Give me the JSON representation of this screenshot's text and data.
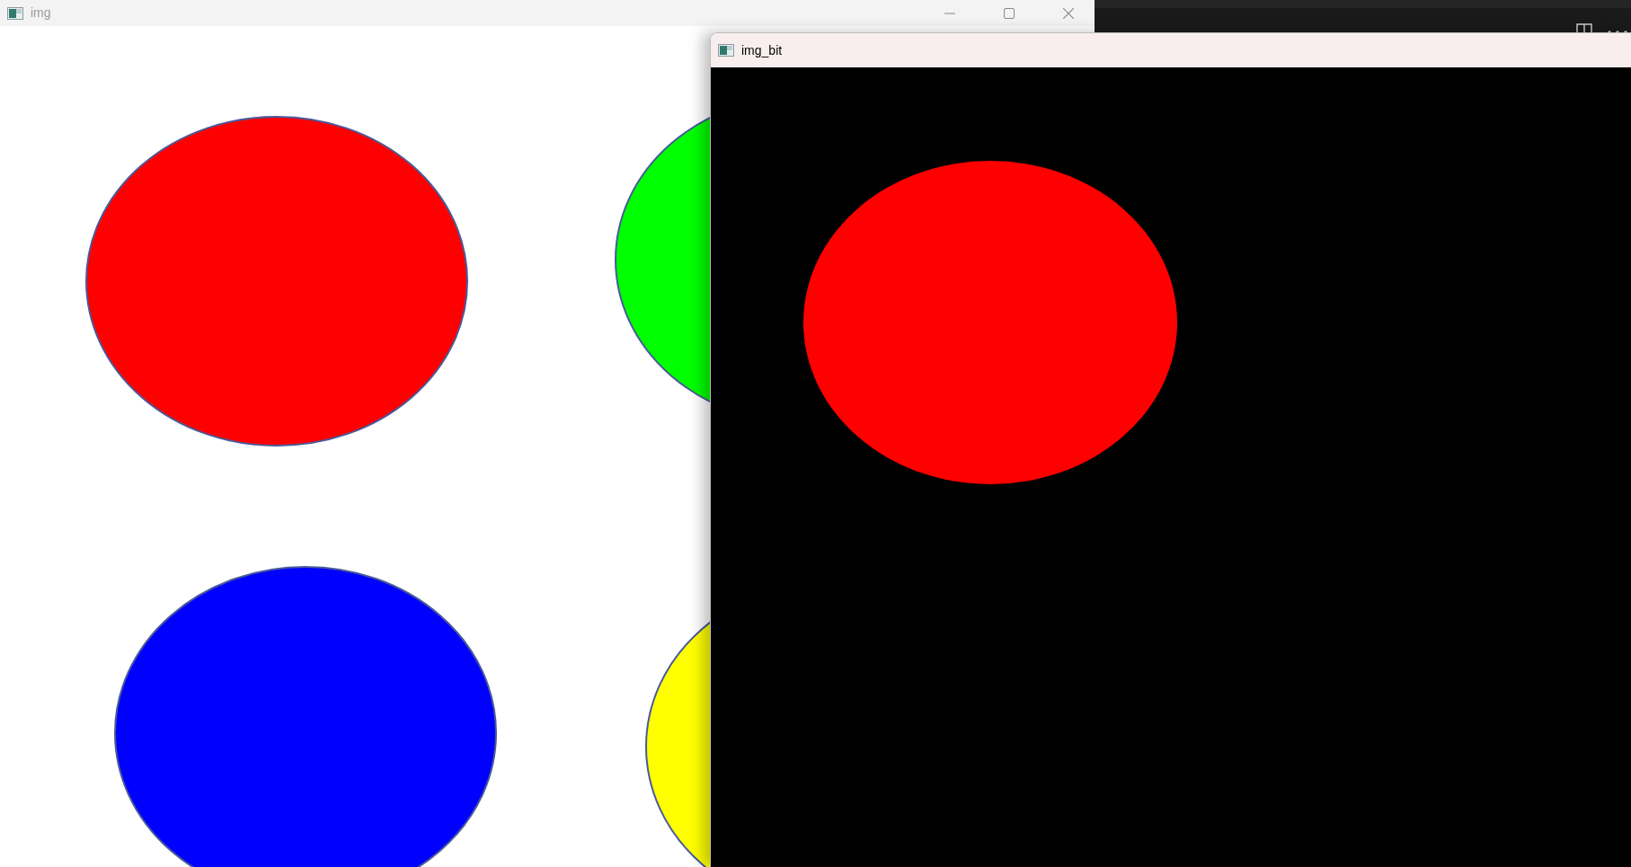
{
  "windows": [
    {
      "title": "img",
      "active": false,
      "shapes": [
        {
          "color": "#ff0000"
        },
        {
          "color": "#00ff00"
        },
        {
          "color": "#0000ff"
        },
        {
          "color": "#ffff00"
        }
      ]
    },
    {
      "title": "img_bit",
      "active": true,
      "shapes": [
        {
          "color": "#ff0000"
        }
      ]
    }
  ]
}
